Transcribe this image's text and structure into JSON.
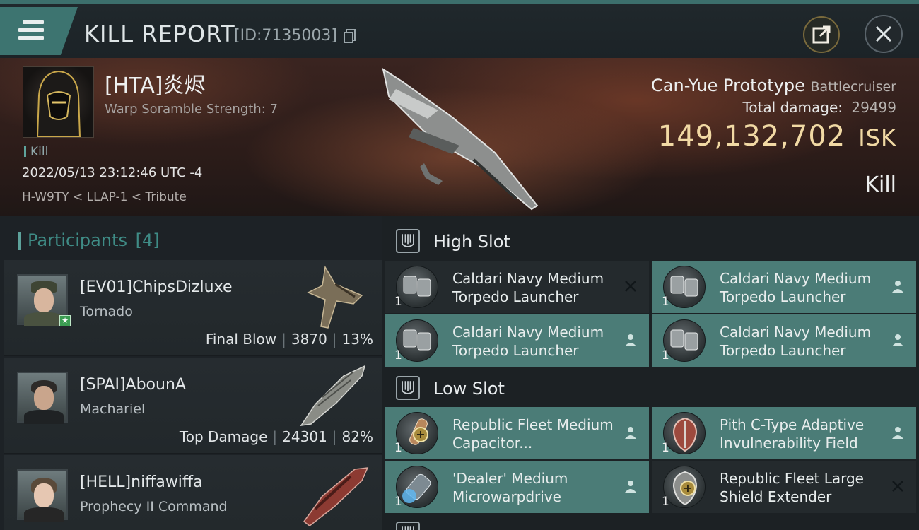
{
  "header": {
    "title": "KILL REPORT",
    "report_id": "[ID:7135003]"
  },
  "victim": {
    "name": "[HTA]炎烬",
    "scramble": "Warp Soramble Strength: 7",
    "kill_tag": "Kill",
    "datetime": "2022/05/13 23:12:46 UTC -4",
    "location": "H-W9TY < LLAP-1 < Tribute",
    "ship_name": "Can-Yue Prototype",
    "ship_class": "Battlecruiser",
    "total_damage_label": "Total damage:",
    "total_damage": "29499",
    "isk_value": "149,132,702",
    "isk_unit": "ISK",
    "kill_type": "Kill"
  },
  "participants": {
    "label": "Participants",
    "count": "[4]",
    "items": [
      {
        "name": "[EV01]ChipsDizluxe",
        "ship": "Tornado",
        "role": "Final Blow",
        "damage": "3870",
        "percent": "13%",
        "badge": "★",
        "color": "#7a6e58"
      },
      {
        "name": "[SPAI]AbounA",
        "ship": "Machariel",
        "role": "Top Damage",
        "damage": "24301",
        "percent": "82%",
        "badge": "",
        "color": "#8a8c86"
      },
      {
        "name": "[HELL]niffawiffa",
        "ship": "Prophecy II Command",
        "role": "",
        "damage": "",
        "percent": "",
        "badge": "",
        "color": "#8c3a32"
      }
    ]
  },
  "fitting": {
    "high_slot_label": "High Slot",
    "low_slot_label": "Low Slot",
    "high": [
      {
        "name": "Caldari Navy Medium Torpedo Launcher",
        "qty": "1",
        "state": "destroyed"
      },
      {
        "name": "Caldari Navy Medium Torpedo Launcher",
        "qty": "1",
        "state": "dropped"
      },
      {
        "name": "Caldari Navy Medium Torpedo Launcher",
        "qty": "1",
        "state": "dropped"
      },
      {
        "name": "Caldari Navy Medium Torpedo Launcher",
        "qty": "1",
        "state": "dropped"
      }
    ],
    "low": [
      {
        "name": "Republic Fleet Medium Capacitor...",
        "qty": "1",
        "state": "dropped"
      },
      {
        "name": "Pith C-Type Adaptive Invulnerability Field",
        "qty": "1",
        "state": "dropped"
      },
      {
        "name": "'Dealer' Medium Microwarpdrive",
        "qty": "1",
        "state": "dropped"
      },
      {
        "name": "Republic Fleet Large Shield Extender",
        "qty": "1",
        "state": "destroyed"
      }
    ],
    "colors": {
      "dropped": "#4b7c77",
      "destroyed": "#242a2d"
    }
  }
}
